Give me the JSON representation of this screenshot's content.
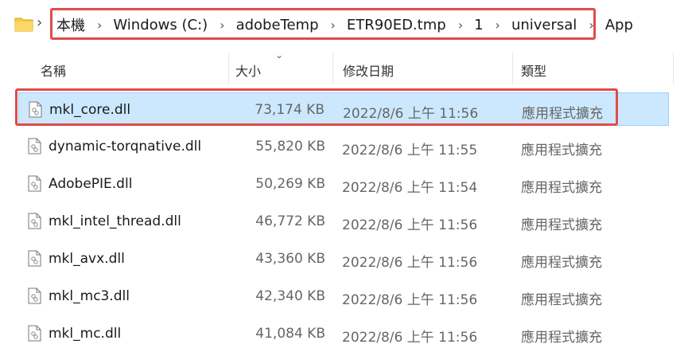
{
  "breadcrumb": {
    "path": [
      "本機",
      "Windows (C:)",
      "adobeTemp",
      "ETR90ED.tmp",
      "1",
      "universal",
      "App"
    ]
  },
  "columns": {
    "name": "名稱",
    "size": "大小",
    "modified": "修改日期",
    "type": "類型"
  },
  "files": [
    {
      "name": "mkl_core.dll",
      "size": "73,174 KB",
      "modified": "2022/8/6 上午 11:56",
      "type": "應用程式擴充",
      "selected": true
    },
    {
      "name": "dynamic-torqnative.dll",
      "size": "55,820 KB",
      "modified": "2022/8/6 上午 11:55",
      "type": "應用程式擴充",
      "selected": false
    },
    {
      "name": "AdobePIE.dll",
      "size": "50,269 KB",
      "modified": "2022/8/6 上午 11:54",
      "type": "應用程式擴充",
      "selected": false
    },
    {
      "name": "mkl_intel_thread.dll",
      "size": "46,772 KB",
      "modified": "2022/8/6 上午 11:56",
      "type": "應用程式擴充",
      "selected": false
    },
    {
      "name": "mkl_avx.dll",
      "size": "43,360 KB",
      "modified": "2022/8/6 上午 11:56",
      "type": "應用程式擴充",
      "selected": false
    },
    {
      "name": "mkl_mc3.dll",
      "size": "42,340 KB",
      "modified": "2022/8/6 上午 11:56",
      "type": "應用程式擴充",
      "selected": false
    },
    {
      "name": "mkl_mc.dll",
      "size": "41,084 KB",
      "modified": "2022/8/6 上午 11:56",
      "type": "應用程式擴充",
      "selected": false
    }
  ],
  "colors": {
    "highlight_box": "#e24a4a",
    "selection_bg": "#cce8ff",
    "folder": "#f7c948"
  }
}
